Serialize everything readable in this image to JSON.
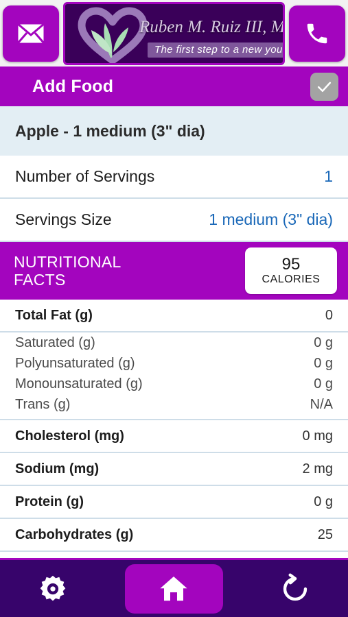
{
  "header": {
    "email_button": {
      "icon": "envelope-icon",
      "label": "Email"
    },
    "phone_button": {
      "icon": "phone-icon",
      "label": "Call"
    },
    "logo": {
      "icon": "heart-leaf-logo",
      "practice_name": "Ruben M. Ruiz III, MD",
      "tagline": "The first step to a new you."
    }
  },
  "title_bar": {
    "title": "Add Food",
    "confirm_button": {
      "icon": "check-icon",
      "label": "Save"
    }
  },
  "food": {
    "name": "Apple - 1 medium (3\" dia)"
  },
  "servings": [
    {
      "label": "Number of Servings",
      "value": "1"
    },
    {
      "label": "Servings Size",
      "value": "1 medium (3\" dia)"
    }
  ],
  "nutrition": {
    "section_title_line1": "NUTRITIONAL",
    "section_title_line2": "FACTS",
    "calories": {
      "amount": "95",
      "unit": "CALORIES"
    },
    "rows": [
      {
        "label": "Total Fat (g)",
        "value": "0",
        "type": "major"
      },
      {
        "label": "Saturated (g)",
        "value": "0 g",
        "type": "sub"
      },
      {
        "label": "Polyunsaturated (g)",
        "value": "0 g",
        "type": "sub"
      },
      {
        "label": "Monounsaturated (g)",
        "value": "0 g",
        "type": "sub"
      },
      {
        "label": "Trans (g)",
        "value": "N/A",
        "type": "sub"
      },
      {
        "label": "Cholesterol (mg)",
        "value": "0 mg",
        "type": "major"
      },
      {
        "label": "Sodium (mg)",
        "value": "2 mg",
        "type": "major"
      },
      {
        "label": "Protein (g)",
        "value": "0 g",
        "type": "major"
      },
      {
        "label": "Carbohydrates (g)",
        "value": "25",
        "type": "major"
      }
    ]
  },
  "bottom_nav": {
    "items": [
      {
        "icon": "gear-icon",
        "label": "Settings",
        "active": false
      },
      {
        "icon": "home-icon",
        "label": "Home",
        "active": true
      },
      {
        "icon": "refresh-back-icon",
        "label": "Back",
        "active": false
      }
    ]
  },
  "colors": {
    "accent_purple": "#a305be",
    "dark_purple": "#37046b",
    "banner_purple": "#3a0059",
    "light_blue_row": "#e3eef4",
    "divider": "#cedde8",
    "value_blue": "#1a68b8"
  }
}
